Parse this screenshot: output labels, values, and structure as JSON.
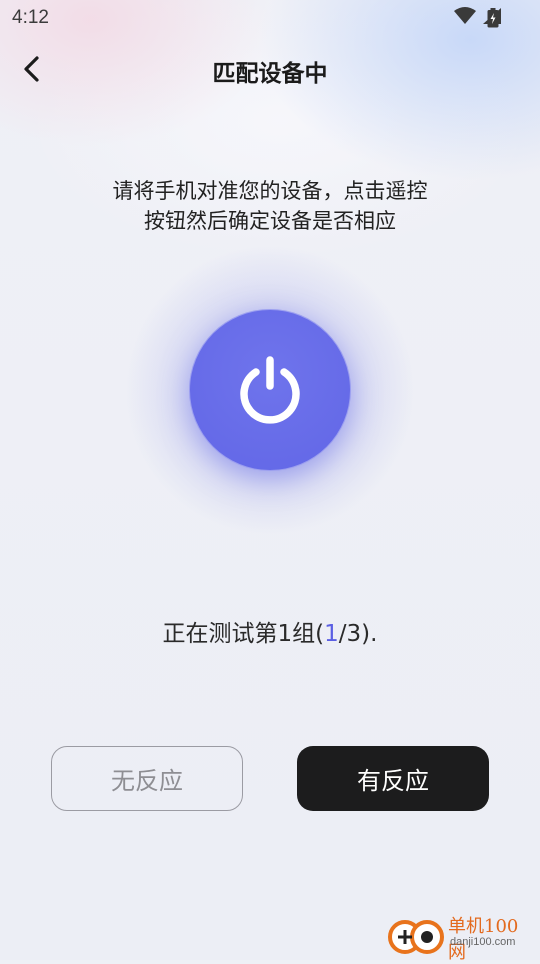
{
  "status_bar": {
    "time": "4:12"
  },
  "header": {
    "title": "匹配设备中",
    "back_icon": "chevron-left-icon"
  },
  "instruction": {
    "line1": "请将手机对准您的设备，点击遥控",
    "line2": "按钮然后确定设备是否相应"
  },
  "power_button": {
    "icon": "power-icon",
    "color": "#6367e8"
  },
  "progress": {
    "prefix": "正在测试第1组(",
    "current": "1",
    "suffix": "/3)."
  },
  "actions": {
    "no_response": "无反应",
    "has_response": "有反应"
  },
  "watermark": {
    "brand": "单机100网",
    "url": "danji100.com"
  },
  "colors": {
    "accent": "#5b5fe3",
    "primary_button": "#1c1c1d",
    "background": "#eef0f6"
  }
}
